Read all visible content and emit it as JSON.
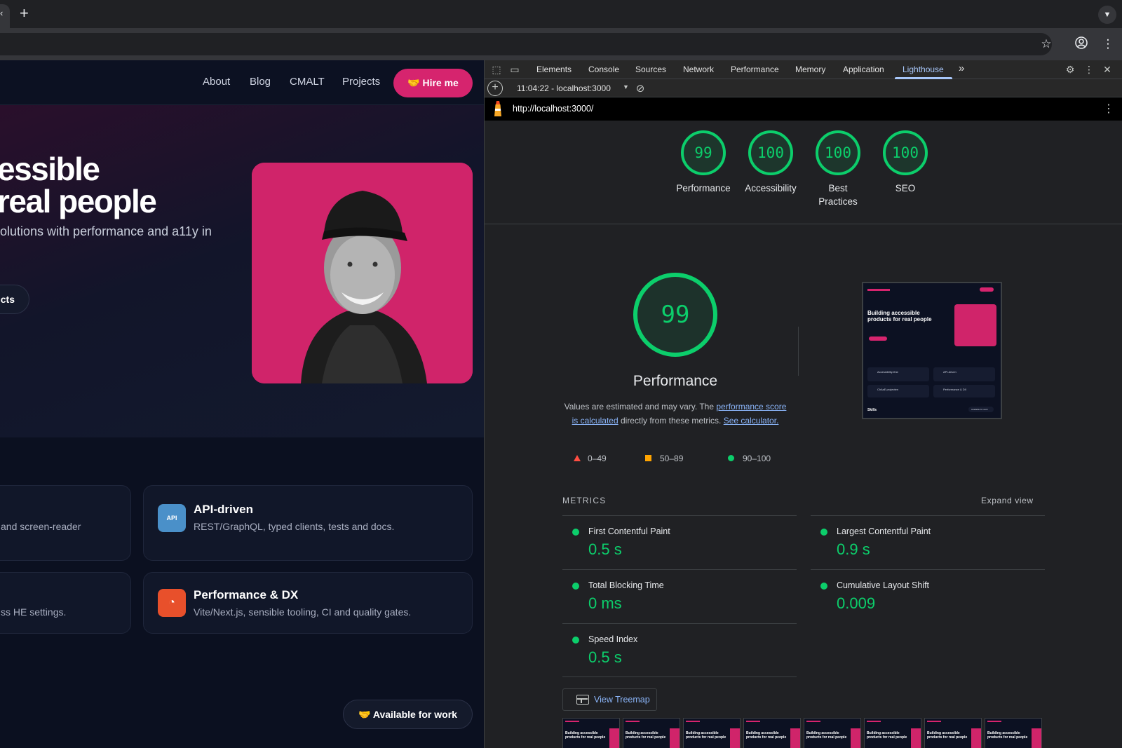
{
  "browser": {
    "new_tab_symbol": "+",
    "close_tab_symbol": "‹",
    "tab_search_icon": "chevron-down-icon",
    "toolbar_icons": [
      "bookmark-star-icon",
      "profile-icon",
      "menu-kebab-icon"
    ]
  },
  "site": {
    "nav": [
      "About",
      "Blog",
      "CMALT",
      "Projects"
    ],
    "hire_label": "Hire me",
    "hero_line1": "essible",
    "hero_line2": "real people",
    "hero_sub": "olutions with performance and a11y in",
    "cta_label": "cts",
    "cards": [
      {
        "title": "",
        "desc": "and screen-reader"
      },
      {
        "title": "API-driven",
        "icon_text": "API",
        "desc": "REST/GraphQL, typed clients, tests and docs."
      },
      {
        "title": "",
        "desc": "ss HE settings."
      },
      {
        "title": "Performance & DX",
        "desc": "Vite/Next.js, sensible tooling, CI and quality gates."
      }
    ],
    "available_label": "Available for work",
    "colors": {
      "accent": "#d6246e",
      "bg": "#0b1020"
    }
  },
  "devtools": {
    "tabs": [
      "Elements",
      "Console",
      "Sources",
      "Network",
      "Performance",
      "Memory",
      "Application",
      "Lighthouse"
    ],
    "active_tab": "Lighthouse",
    "overflow": "»",
    "report_select": "11:04:22 - localhost:3000",
    "url": "http://localhost:3000/",
    "scores": [
      {
        "value": "99",
        "label": "Performance"
      },
      {
        "value": "100",
        "label": "Accessibility"
      },
      {
        "value": "100",
        "label": "Best Practices"
      },
      {
        "value": "100",
        "label": "SEO"
      }
    ],
    "performance": {
      "score": "99",
      "title": "Performance",
      "desc_1": "Values are estimated and may vary. The ",
      "desc_link1": "performance score is calculated",
      "desc_2": " directly from these metrics. ",
      "desc_link2": "See calculator."
    },
    "legend": [
      {
        "range": "0–49",
        "color": "#ff4e42",
        "shape": "triangle"
      },
      {
        "range": "50–89",
        "color": "#ffa400",
        "shape": "square"
      },
      {
        "range": "90–100",
        "color": "#0cce6b",
        "shape": "circle"
      }
    ],
    "metrics_title": "METRICS",
    "expand_label": "Expand view",
    "metrics": [
      {
        "name": "First Contentful Paint",
        "value": "0.5 s"
      },
      {
        "name": "Largest Contentful Paint",
        "value": "0.9 s"
      },
      {
        "name": "Total Blocking Time",
        "value": "0 ms"
      },
      {
        "name": "Cumulative Layout Shift",
        "value": "0.009"
      },
      {
        "name": "Speed Index",
        "value": "0.5 s"
      }
    ],
    "treemap_label": "View Treemap",
    "thumb_heading": "Building accessible products for real people",
    "thumb_cards": [
      "Accessibility-first",
      "API-driven",
      "ChAsE projecten",
      "Performance & DX"
    ],
    "thumb_footer": "Skills",
    "thumb_button": "Available for work",
    "film_heading": "Building accessible products for real people",
    "score_color": "#0cce6b"
  }
}
